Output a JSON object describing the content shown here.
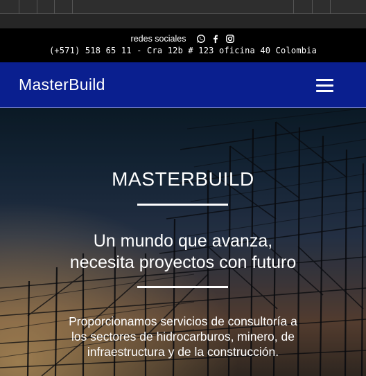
{
  "topbar": {
    "social_label": "redes sociales",
    "social_icons": [
      "whatsapp-icon",
      "facebook-icon",
      "instagram-icon"
    ],
    "contact": "(+571) 518 65 11 - Cra 12b # 123 oficina 40 Colombia"
  },
  "nav": {
    "brand": "MasterBuild",
    "menu_icon": "hamburger-menu-icon",
    "color": "#0a1f8f"
  },
  "hero": {
    "title": "MASTERBUILD",
    "subtitle_line1": "Un mundo que avanza,",
    "subtitle_line2": "necesita proyectos con futuro",
    "desc_line1": "Proporcionamos servicios de consultoría a",
    "desc_line2": "los sectores de hidrocarburos, minero, de",
    "desc_line3": "infraestructura y de la construcción."
  }
}
